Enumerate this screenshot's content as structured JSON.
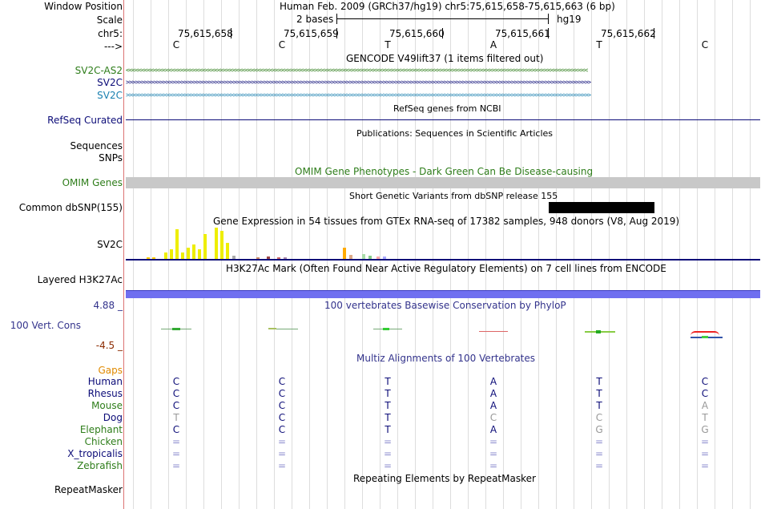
{
  "header": {
    "window_position_label": "Window Position",
    "assembly_text": "Human Feb. 2009 (GRCh37/hg19)   chr5:75,615,658-75,615,663 (6 bp)",
    "scale_label": "Scale",
    "scale_value": "2 bases",
    "scale_db": "hg19",
    "chrom_label": "chr5:",
    "strand_label": "--->",
    "positions": [
      "75,615,658",
      "75,615,659",
      "75,615,660",
      "75,615,661",
      "75,615,662"
    ],
    "bases": [
      "C",
      "C",
      "T",
      "A",
      "T",
      "C"
    ]
  },
  "tracks": {
    "gencode": {
      "title": "GENCODE V49lift37 (1 items filtered out)",
      "items": [
        {
          "label": "SV2C-AS2",
          "color": "#2e7d1a",
          "glyphs": "<<<<<<<<<<<<<<<<<<<<<<<<<<<<<<<<<<<<<<<<<<<<<<<<<<<<<<<<<<<<<<<<<<<<<<<<<<<<<<<<<<<<<<<<<<<<<<<<<<<<<<<<<<<<<<<<<<<<<<<<<<<<<<<<<<<<<<<<<<<<<<<<<<<<<<<"
        },
        {
          "label": "SV2C",
          "color": "#0c0c78",
          "glyphs": ">>>>>>>>>>>>>>>>>>>>>>>>>>>>>>>>>>>>>>>>>>>>>>>>>>>>>>>>>>>>>>>>>>>>>>>>>>>>>>>>>>>>>>>>>>>>>>>>>>>>>>>>>>>>>>>>>>>>>>>>>>>>>>>>>>>>>>>>>>>>>>>>>>>>>>>>"
        },
        {
          "label": "SV2C",
          "color": "#1a80b0",
          "glyphs": ">>>>>>>>>>>>>>>>>>>>>>>>>>>>>>>>>>>>>>>>>>>>>>>>>>>>>>>>>>>>>>>>>>>>>>>>>>>>>>>>>>>>>>>>>>>>>>>>>>>>>>>>>>>>>>>>>>>>>>>>>>>>>>>>>>>>>>>>>>>>>>>>>>>>>>>>"
        }
      ]
    },
    "refseq": {
      "title": "RefSeq genes from NCBI",
      "label": "RefSeq Curated"
    },
    "publications": {
      "title": "Publications: Sequences in Scientific Articles",
      "label_line1": "Sequences",
      "label_line2": "SNPs"
    },
    "omim": {
      "title": "OMIM Gene Phenotypes - Dark Green Can Be Disease-causing",
      "label": "OMIM Genes"
    },
    "dbsnp": {
      "title": "Short Genetic Variants from dbSNP release 155",
      "label": "Common dbSNP(155)"
    },
    "gtex": {
      "title": "Gene Expression in 54 tissues from GTEx RNA-seq of 17382 samples, 948 donors (V8, Aug 2019)",
      "label": "SV2C",
      "bars": [
        {
          "v": 0.05,
          "c": "#ffcc00"
        },
        {
          "v": 0.05,
          "c": "#ffcc00"
        },
        {
          "v": 0.2,
          "c": "#eeee00"
        },
        {
          "v": 0.3,
          "c": "#eeee00"
        },
        {
          "v": 0.95,
          "c": "#eeee00"
        },
        {
          "v": 0.2,
          "c": "#eeee00"
        },
        {
          "v": 0.35,
          "c": "#eeee00"
        },
        {
          "v": 0.45,
          "c": "#eeee00"
        },
        {
          "v": 0.3,
          "c": "#eeee00"
        },
        {
          "v": 0.8,
          "c": "#eeee00"
        },
        {
          "v": 1.0,
          "c": "#eeee00"
        },
        {
          "v": 0.9,
          "c": "#eeee00"
        },
        {
          "v": 0.5,
          "c": "#eeee00"
        },
        {
          "v": 0.1,
          "c": "#aaaaaa"
        },
        {
          "v": 0.05,
          "c": "#cc8866"
        },
        {
          "v": 0.08,
          "c": "#994444"
        },
        {
          "v": 0.06,
          "c": "#cc6666"
        },
        {
          "v": 0.05,
          "c": "#aa88aa"
        },
        {
          "v": 0.35,
          "c": "#ffaa00"
        },
        {
          "v": 0.12,
          "c": "#ddaa88"
        },
        {
          "v": 0.15,
          "c": "#aaddaa"
        },
        {
          "v": 0.1,
          "c": "#88cc88"
        },
        {
          "v": 0.08,
          "c": "#ffaaaa"
        },
        {
          "v": 0.08,
          "c": "#aaaaff"
        }
      ]
    },
    "h3k27ac": {
      "title": "H3K27Ac Mark (Often Found Near Active Regulatory Elements) on 7 cell lines from ENCODE",
      "label": "Layered H3K27Ac"
    },
    "phylop": {
      "title": "100 vertebrates Basewise Conservation by PhyloP",
      "label": "100 Vert. Cons",
      "max": "4.88 _",
      "min": "-4.5 _"
    },
    "multiz": {
      "title": "Multiz Alignments of 100 Vertebrates",
      "gaps_label": "Gaps",
      "species": [
        {
          "name": "Human",
          "color": "#0c0c78",
          "bases": [
            "C",
            "C",
            "T",
            "A",
            "T",
            "C"
          ]
        },
        {
          "name": "Rhesus",
          "color": "#0c0c78",
          "bases": [
            "C",
            "C",
            "T",
            "A",
            "T",
            "C"
          ]
        },
        {
          "name": "Mouse",
          "color": "#2e7d1a",
          "bases": [
            "C",
            "C",
            "T",
            "A",
            "T",
            "A"
          ]
        },
        {
          "name": "Dog",
          "color": "#0c0c78",
          "bases": [
            "T",
            "C",
            "T",
            "C",
            "C",
            "T"
          ]
        },
        {
          "name": "Elephant",
          "color": "#2e7d1a",
          "bases": [
            "C",
            "C",
            "T",
            "A",
            "G",
            "G"
          ]
        },
        {
          "name": "Chicken",
          "color": "#2e7d1a",
          "bases": [
            "=",
            "=",
            "=",
            "=",
            "=",
            "="
          ]
        },
        {
          "name": "X_tropicalis",
          "color": "#0c0c78",
          "bases": [
            "=",
            "=",
            "=",
            "=",
            "=",
            "="
          ]
        },
        {
          "name": "Zebrafish",
          "color": "#2e7d1a",
          "bases": [
            "=",
            "=",
            "=",
            "=",
            "=",
            "="
          ]
        }
      ]
    },
    "repeatmasker": {
      "title": "Repeating Elements by RepeatMasker",
      "label": "RepeatMasker"
    }
  }
}
